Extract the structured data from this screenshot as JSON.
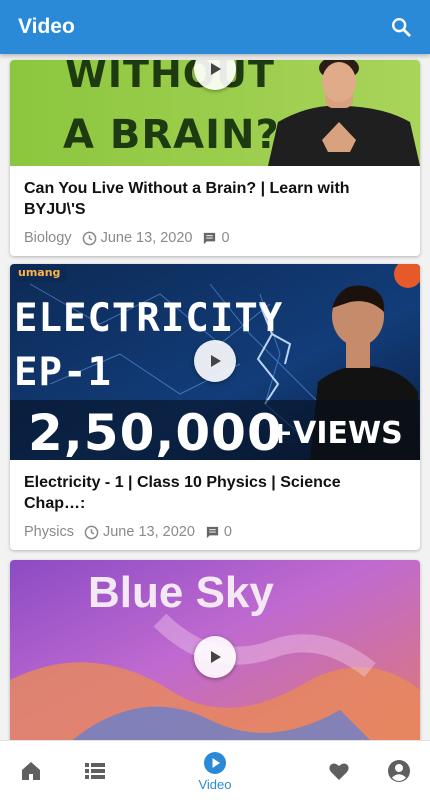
{
  "appbar": {
    "title": "Video",
    "search_icon": "search-icon"
  },
  "videos": [
    {
      "thumb_text_1": "WITHOUT",
      "thumb_text_2": "A BRAIN?",
      "title": "Can You Live Without a Brain? | Learn with BYJU\\'S",
      "category": "Biology",
      "date": "June 13, 2020",
      "comments": "0"
    },
    {
      "thumb_brand": "umang",
      "thumb_text_1": "ELECTRICITY",
      "thumb_text_2": "EP-1",
      "thumb_text_3": "2,50,000",
      "thumb_text_4": "+VIEWS",
      "title": "Electricity - 1 | Class 10 Physics | Science Chap…:",
      "category": "Physics",
      "date": "June 13, 2020",
      "comments": "0"
    },
    {
      "thumb_text_1": "Blue Sky"
    }
  ],
  "bottom_nav": {
    "items": [
      {
        "icon": "home-icon"
      },
      {
        "icon": "list-icon"
      },
      {
        "icon": "play-circle-icon",
        "label": "Video",
        "active": true
      },
      {
        "icon": "heart-icon"
      },
      {
        "icon": "account-icon"
      }
    ]
  },
  "colors": {
    "primary": "#2a8ad8",
    "inactive_icon": "#5f5f5f",
    "meta_text": "#8a8a8a"
  }
}
